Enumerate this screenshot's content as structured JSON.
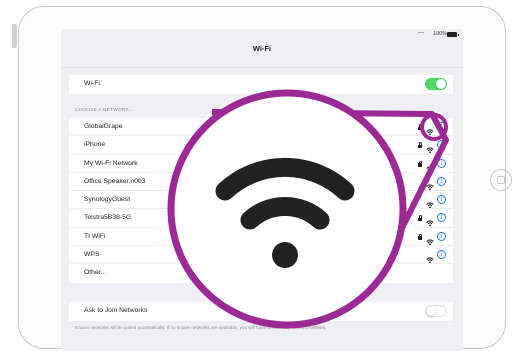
{
  "statusbar": {
    "signal": "—",
    "battery_pct": "100%",
    "battery_icon": "battery-full-icon"
  },
  "navbar": {
    "title": "Wi-Fi"
  },
  "wifi_toggle_row": {
    "label": "Wi-Fi",
    "state": "on"
  },
  "section": {
    "header": "CHOOSE A NETWORK..."
  },
  "networks": [
    {
      "name": "GlobalGrape",
      "locked": true,
      "info": true
    },
    {
      "name": "iPhone",
      "locked": true,
      "info": true
    },
    {
      "name": "My Wi-Fi Network",
      "locked": true,
      "info": true
    },
    {
      "name": "Office Speaker.n003",
      "locked": false,
      "info": true
    },
    {
      "name": "SynologyGuest",
      "locked": false,
      "info": true
    },
    {
      "name": "Telstra5B38-5G",
      "locked": true,
      "info": true
    },
    {
      "name": "TI WiFi",
      "locked": true,
      "info": true
    },
    {
      "name": "WPS",
      "locked": false,
      "info": true
    },
    {
      "name": "Other...",
      "locked": false,
      "info": false
    }
  ],
  "ask_to_join": {
    "label": "Ask to Join Networks",
    "state": "off"
  },
  "footer": {
    "note": "Known networks will be joined automatically. If no known networks are available, you will have to manually select a network."
  },
  "icons": {
    "info": "i"
  },
  "colors": {
    "accent": "#1a7cf5",
    "toggle_on": "#4cd964",
    "callout": "#9b2a94",
    "wifi_glyph": "#222222"
  }
}
